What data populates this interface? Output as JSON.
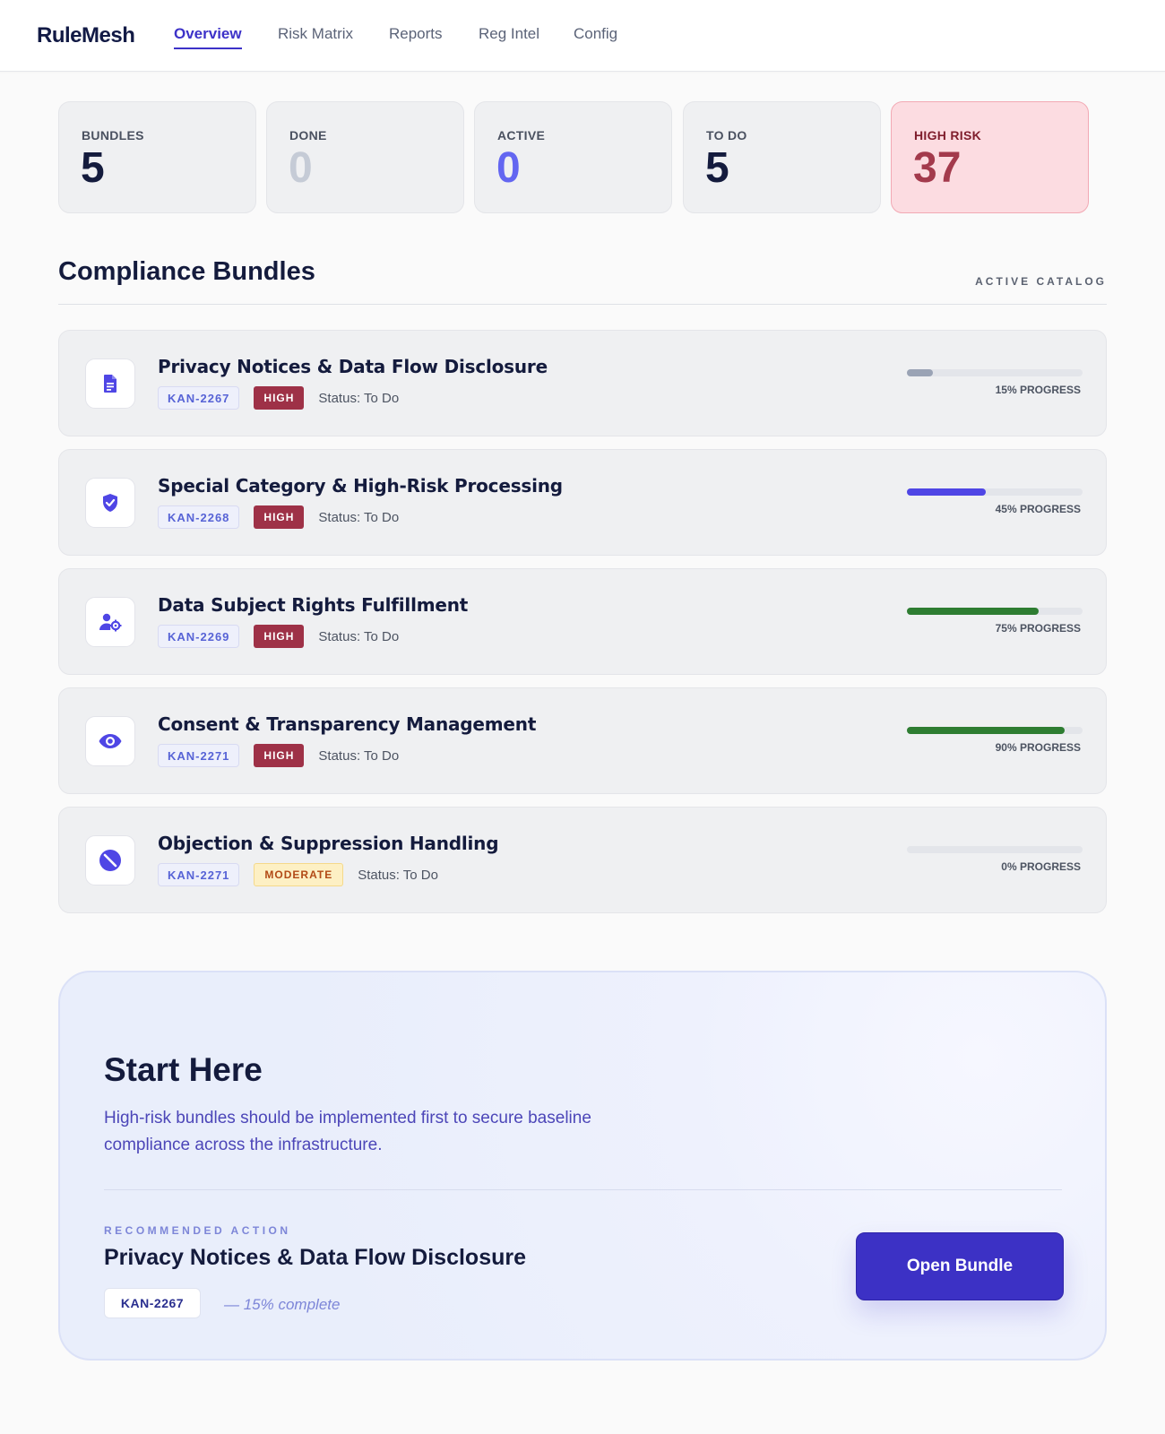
{
  "nav": {
    "brand": "RuleMesh",
    "links": [
      "Overview",
      "Risk Matrix",
      "Reports",
      "Reg Intel",
      "Config"
    ],
    "active": "Overview"
  },
  "stats": [
    {
      "label": "BUNDLES",
      "value": "5",
      "color": "#141b3d"
    },
    {
      "label": "DONE",
      "value": "0",
      "color": "#c5cbd6"
    },
    {
      "label": "ACTIVE",
      "value": "0",
      "color": "#6366f1"
    },
    {
      "label": "TO DO",
      "value": "5",
      "color": "#141b3d"
    },
    {
      "label": "HIGH RISK",
      "value": "37",
      "color": "#a33a4c"
    }
  ],
  "section": {
    "title": "Compliance Bundles",
    "tag": "ACTIVE CATALOG"
  },
  "bundles": [
    {
      "title": "Privacy Notices & Data Flow Disclosure",
      "id": "KAN-2267",
      "risk": "HIGH",
      "status": "Status: To Do",
      "progress": 15,
      "progress_label": "15% PROGRESS",
      "bar_color": "#9aa3b5",
      "icon": "document-icon"
    },
    {
      "title": "Special Category & High-Risk Processing",
      "id": "KAN-2268",
      "risk": "HIGH",
      "status": "Status: To Do",
      "progress": 45,
      "progress_label": "45% PROGRESS",
      "bar_color": "#4f46e5",
      "icon": "shield-check-icon"
    },
    {
      "title": "Data Subject Rights Fulfillment",
      "id": "KAN-2269",
      "risk": "HIGH",
      "status": "Status: To Do",
      "progress": 75,
      "progress_label": "75% PROGRESS",
      "bar_color": "#2e7d32",
      "icon": "user-gear-icon"
    },
    {
      "title": "Consent & Transparency Management",
      "id": "KAN-2271",
      "risk": "HIGH",
      "status": "Status: To Do",
      "progress": 90,
      "progress_label": "90% PROGRESS",
      "bar_color": "#2e7d32",
      "icon": "eye-icon"
    },
    {
      "title": "Objection & Suppression Handling",
      "id": "KAN-2271",
      "risk": "MODERATE",
      "status": "Status: To Do",
      "progress": 0,
      "progress_label": "0% PROGRESS",
      "bar_color": "#9aa3b5",
      "icon": "block-icon"
    }
  ],
  "start_here": {
    "title": "Start Here",
    "description": "High-risk bundles should be implemented first to secure baseline compliance across the infrastructure.",
    "recommended_label": "RECOMMENDED ACTION",
    "recommended_title": "Privacy Notices & Data Flow Disclosure",
    "recommended_id": "KAN-2267",
    "recommended_pct": "— 15% complete",
    "button_label": "Open Bundle"
  },
  "colors": {
    "accent": "#3c31c5",
    "icon": "#4f46e5",
    "high_risk": "#9e3147"
  }
}
